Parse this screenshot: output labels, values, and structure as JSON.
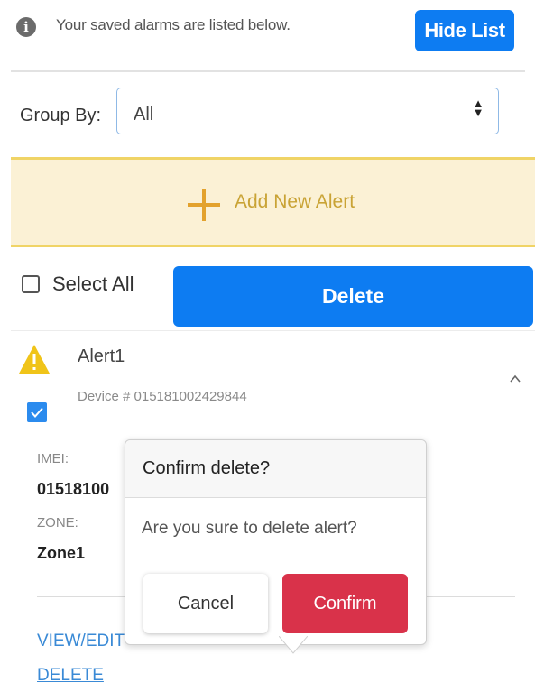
{
  "info": {
    "text": "Your saved alarms are listed below.",
    "icon": "info-icon",
    "hide_list_label": "Hide List"
  },
  "group_by": {
    "label": "Group By:",
    "value": "All"
  },
  "add_alert": {
    "label": "Add New Alert",
    "icon": "plus-icon"
  },
  "bulk": {
    "select_all_label": "Select All",
    "select_all_checked": false,
    "delete_label": "Delete"
  },
  "alert": {
    "name": "Alert1",
    "device_line": "Device # 015181002429844",
    "icon": "warning-icon",
    "checked": true,
    "imei_label": "IMEI:",
    "imei_value": "01518100",
    "zone_label": "ZONE:",
    "zone_value": "Zone1",
    "view_edit_label": "VIEW/EDIT",
    "delete_label": "DELETE"
  },
  "confirm_popover": {
    "title": "Confirm delete?",
    "message": "Are you sure to delete alert?",
    "cancel_label": "Cancel",
    "confirm_label": "Confirm"
  },
  "colors": {
    "primary": "#0d7cf2",
    "danger": "#d9324a",
    "warning": "#f0c419",
    "add_alert_bg": "#fbf1d5",
    "add_alert_accent": "#e3a22d",
    "link": "#3a8ad6"
  }
}
